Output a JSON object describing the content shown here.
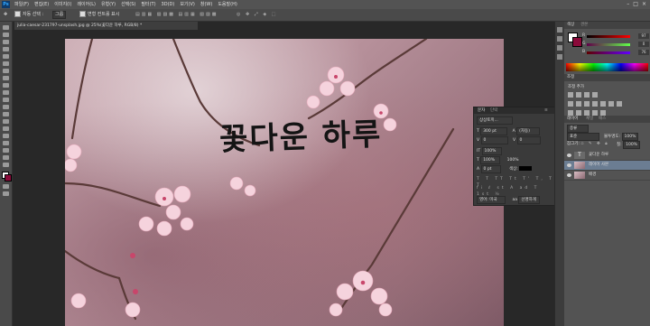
{
  "app": {
    "logo": "Ps"
  },
  "menu": [
    "파일(F)",
    "편집(E)",
    "이미지(I)",
    "레이어(L)",
    "유형(Y)",
    "선택(S)",
    "필터(T)",
    "3D(D)",
    "보기(V)",
    "창(W)",
    "도움말(H)"
  ],
  "window_controls": [
    "–",
    "□",
    "×"
  ],
  "options": {
    "auto_select_label": "자동 선택 :",
    "auto_select_value": "그룹",
    "transform_label": "변형 컨트롤 표시"
  },
  "document": {
    "tab_title": "julia-caesar-231797-unsplash.jpg @ 25%(꽃다운 하루, RGB/8) *"
  },
  "canvas": {
    "headline": "꽃다운 하루"
  },
  "character_panel": {
    "tabs": [
      "문자",
      "단락"
    ],
    "font_family": "상상토끼...",
    "font_size": "300 pt",
    "leading": "(자동)",
    "kerning": "0",
    "tracking": "0",
    "scale_v": "100%",
    "scale_h": "100%",
    "baseline": "0 pt",
    "color_label": "색상:",
    "language": "영어: 미국",
    "antialias": "선명하게"
  },
  "right_panel": {
    "color_tabs": [
      "색상",
      "견본"
    ],
    "rgb": [
      {
        "label": "R",
        "value": "97"
      },
      {
        "label": "G",
        "value": "0"
      },
      {
        "label": "B",
        "value": "76"
      }
    ],
    "adjust_tab": "조정",
    "adjust_label": "조정 추가",
    "layers_tabs": [
      "레이어",
      "채널",
      "패스"
    ],
    "kind_label": "종류",
    "blend_mode": "표준",
    "opacity_label": "불투명도:",
    "opacity_value": "100%",
    "lock_label": "잠그기:",
    "fill_label": "칠:",
    "fill_value": "100%",
    "layers": [
      {
        "name": "꽃다운 하루",
        "type": "text"
      },
      {
        "name": "레이어 사본",
        "type": "image",
        "selected": true
      },
      {
        "name": "배경",
        "type": "image"
      }
    ]
  },
  "colors": {
    "foreground": "#ffffff",
    "background": "#8b0a3a",
    "accent": "#31a8ff"
  }
}
